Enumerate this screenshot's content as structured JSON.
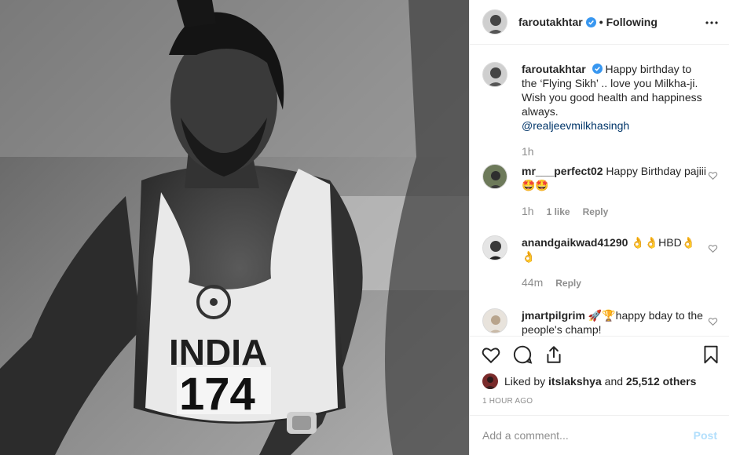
{
  "photo": {
    "alt_icon": "athlete-photo",
    "jersey_text": "INDIA",
    "bib_number": "174"
  },
  "header": {
    "username": "faroutakhtar",
    "separator": "•",
    "follow_status": "Following",
    "more_icon": "more-options-icon"
  },
  "caption": {
    "username": "faroutakhtar",
    "text": "Happy birthday to the ‘Flying Sikh’ .. love you Milkha-ji. Wish you good health and happiness always.",
    "mention": "@realjeevmilkhasingh",
    "time": "1h"
  },
  "comments": [
    {
      "username": "mr___perfect02",
      "text": "Happy Birthday pajiii🤩🤩",
      "time": "1h",
      "likes": "1 like",
      "reply": "Reply"
    },
    {
      "username": "anandgaikwad41290",
      "text": "👌👌HBD👌👌",
      "time": "44m",
      "reply": "Reply"
    },
    {
      "username": "jmartpilgrim",
      "text": "🚀🏆happy bday to the people's champ!"
    }
  ],
  "likes": {
    "prefix": "Liked by",
    "user": "itslakshya",
    "joiner": "and",
    "count": "25,512 others"
  },
  "timestamp": "1 HOUR AGO",
  "add_comment": {
    "placeholder": "Add a comment...",
    "post_label": "Post"
  },
  "colors": {
    "verified": "#3897f0",
    "link": "#003569",
    "muted": "#8e8e8e",
    "post_disabled": "#b2dffc"
  }
}
